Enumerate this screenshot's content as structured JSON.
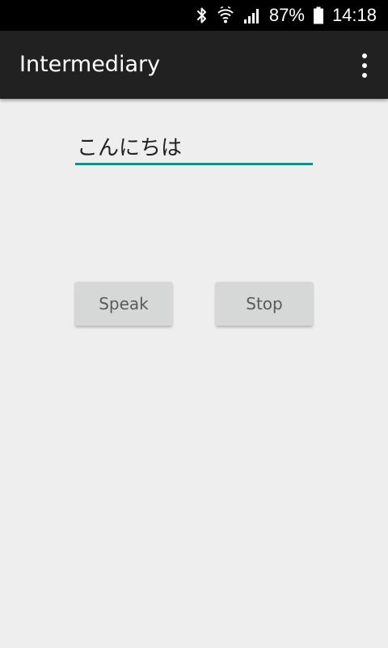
{
  "status_bar": {
    "battery_percent": "87%",
    "time": "14:18",
    "icons": [
      "bluetooth-icon",
      "wifi-icon",
      "signal-icon",
      "battery-icon"
    ]
  },
  "app_bar": {
    "title": "Intermediary",
    "menu_icon": "overflow-menu-icon"
  },
  "main": {
    "text_input": {
      "value": "こんにちは",
      "placeholder": ""
    },
    "speak_button": "Speak",
    "stop_button": "Stop"
  },
  "colors": {
    "status_bar_bg": "#000000",
    "app_bar_bg": "#212121",
    "content_bg": "#eeeeee",
    "accent": "#009688",
    "button_bg": "#d6d7d7"
  }
}
